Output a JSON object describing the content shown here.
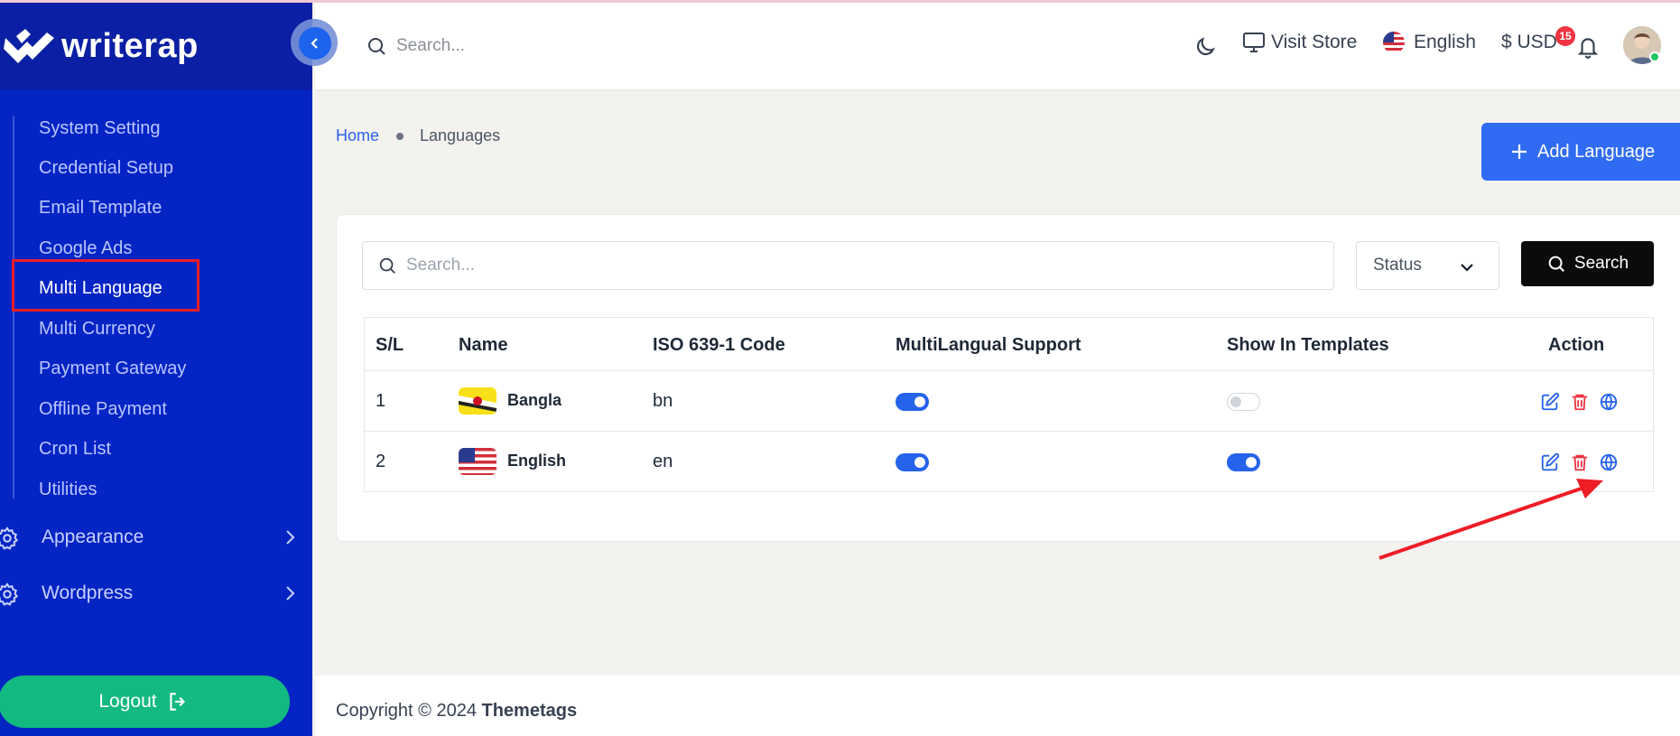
{
  "app": {
    "logo_text": "writerap"
  },
  "sidebar": {
    "sub_items": [
      {
        "label": "System Setting",
        "active": false
      },
      {
        "label": "Credential Setup",
        "active": false
      },
      {
        "label": "Email Template",
        "active": false
      },
      {
        "label": "Google Ads",
        "active": false
      },
      {
        "label": "Multi Language",
        "active": true
      },
      {
        "label": "Multi Currency",
        "active": false
      },
      {
        "label": "Payment Gateway",
        "active": false
      },
      {
        "label": "Offline Payment",
        "active": false
      },
      {
        "label": "Cron List",
        "active": false
      },
      {
        "label": "Utilities",
        "active": false
      }
    ],
    "groups": [
      {
        "label": "Appearance",
        "icon": "gear-icon"
      },
      {
        "label": "Wordpress",
        "icon": "gear-icon"
      }
    ],
    "logout_label": "Logout"
  },
  "header": {
    "search_placeholder": "Search...",
    "visit_store_label": "Visit Store",
    "language_label": "English",
    "currency_label": "$ USD",
    "notification_count": "15"
  },
  "breadcrumb": {
    "home": "Home",
    "current": "Languages"
  },
  "add_button_label": "Add Language",
  "filters": {
    "search_placeholder": "Search...",
    "status_label": "Status",
    "search_button_label": "Search"
  },
  "table": {
    "columns": [
      "S/L",
      "Name",
      "ISO 639-1 Code",
      "MultiLangual Support",
      "Show In Templates",
      "Action"
    ],
    "rows": [
      {
        "sl": "1",
        "name": "Bangla",
        "code": "bn",
        "multilingual": true,
        "show_in_templates": false
      },
      {
        "sl": "2",
        "name": "English",
        "code": "en",
        "multilingual": true,
        "show_in_templates": true
      }
    ]
  },
  "footer": {
    "prefix": "Copyright © 2024",
    "brand": "Themetags"
  },
  "colors": {
    "sidebar": "#0524c4",
    "primary": "#2f6cf3",
    "success": "#12b981",
    "danger": "#ef3340"
  }
}
